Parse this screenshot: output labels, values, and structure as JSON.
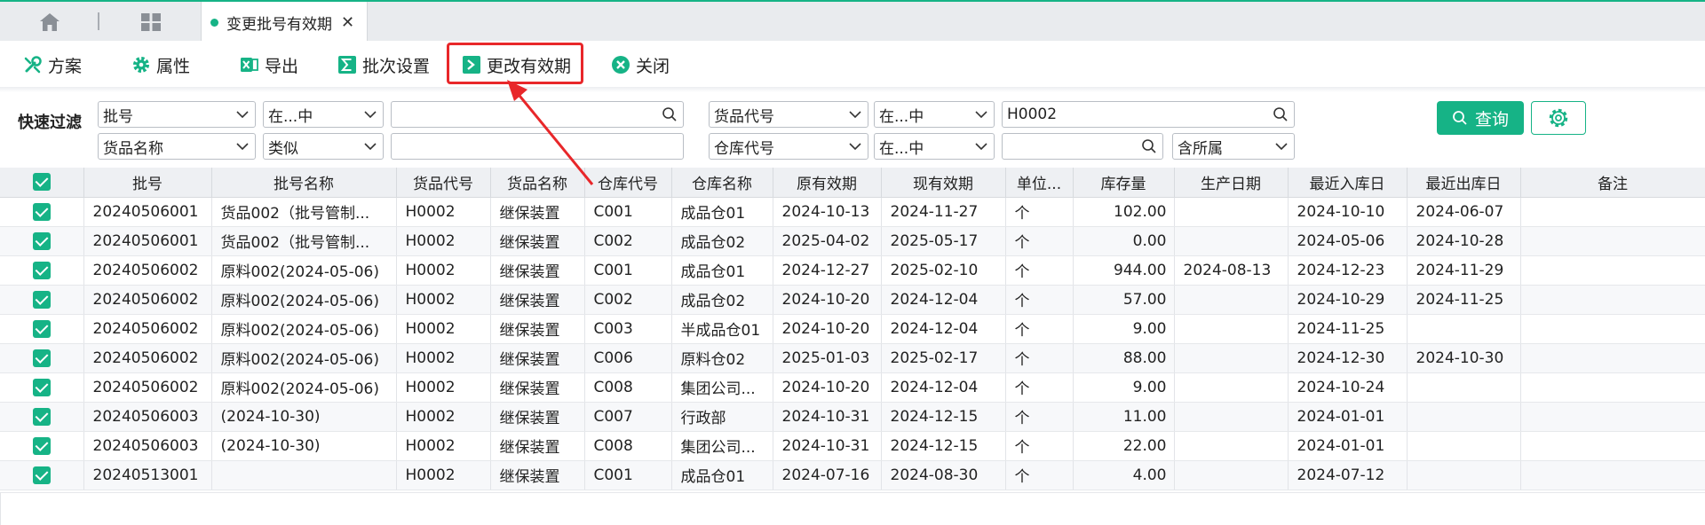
{
  "tabs": {
    "active_label": "变更批号有效期",
    "close_glyph": "✕"
  },
  "toolbar": {
    "items": [
      {
        "label": "方案",
        "icon": "wrench-scheme-icon"
      },
      {
        "label": "属性",
        "icon": "gear-icon"
      },
      {
        "label": "导出",
        "icon": "excel-export-icon"
      },
      {
        "label": "批次设置",
        "icon": "sigma-icon"
      },
      {
        "label": "更改有效期",
        "icon": "terminal-arrow-icon"
      },
      {
        "label": "关闭",
        "icon": "close-circle-icon"
      }
    ]
  },
  "filter": {
    "title": "快速过滤",
    "row1": {
      "field1": "批号",
      "op1": "在...中",
      "value1": "",
      "field2": "货品代号",
      "op2": "在...中",
      "value2": "H0002"
    },
    "row2": {
      "field1": "货品名称",
      "op1": "类似",
      "value1": "",
      "field2": "仓库代号",
      "op2": "在...中",
      "value2": "",
      "scope": "含所属"
    },
    "query_label": "查询"
  },
  "grid": {
    "columns": [
      "批号",
      "批号名称",
      "货品代号",
      "货品名称",
      "仓库代号",
      "仓库名称",
      "原有效期",
      "现有效期",
      "单位...",
      "库存量",
      "生产日期",
      "最近入库日",
      "最近出库日",
      "备注"
    ],
    "rows": [
      [
        "20240506001",
        "货品002（批号管制...",
        "H0002",
        "继保装置",
        "C001",
        "成品仓01",
        "2024-10-13",
        "2024-11-27",
        "个",
        "102.00",
        "",
        "2024-10-10",
        "2024-06-07",
        ""
      ],
      [
        "20240506001",
        "货品002（批号管制...",
        "H0002",
        "继保装置",
        "C002",
        "成品仓02",
        "2025-04-02",
        "2025-05-17",
        "个",
        "0.00",
        "",
        "2024-05-06",
        "2024-10-28",
        ""
      ],
      [
        "20240506002",
        "原料002(2024-05-06)",
        "H0002",
        "继保装置",
        "C001",
        "成品仓01",
        "2024-12-27",
        "2025-02-10",
        "个",
        "944.00",
        "2024-08-13",
        "2024-12-23",
        "2024-11-29",
        ""
      ],
      [
        "20240506002",
        "原料002(2024-05-06)",
        "H0002",
        "继保装置",
        "C002",
        "成品仓02",
        "2024-10-20",
        "2024-12-04",
        "个",
        "57.00",
        "",
        "2024-10-29",
        "2024-11-25",
        ""
      ],
      [
        "20240506002",
        "原料002(2024-05-06)",
        "H0002",
        "继保装置",
        "C003",
        "半成品仓01",
        "2024-10-20",
        "2024-12-04",
        "个",
        "9.00",
        "",
        "2024-11-25",
        "",
        ""
      ],
      [
        "20240506002",
        "原料002(2024-05-06)",
        "H0002",
        "继保装置",
        "C006",
        "原料仓02",
        "2025-01-03",
        "2025-02-17",
        "个",
        "88.00",
        "",
        "2024-12-30",
        "2024-10-30",
        ""
      ],
      [
        "20240506002",
        "原料002(2024-05-06)",
        "H0002",
        "继保装置",
        "C008",
        "集团公司...",
        "2024-10-20",
        "2024-12-04",
        "个",
        "9.00",
        "",
        "2024-10-24",
        "",
        ""
      ],
      [
        "20240506003",
        "(2024-10-30)",
        "H0002",
        "继保装置",
        "C007",
        "行政部",
        "2024-10-31",
        "2024-12-15",
        "个",
        "11.00",
        "",
        "2024-01-01",
        "",
        ""
      ],
      [
        "20240506003",
        "(2024-10-30)",
        "H0002",
        "继保装置",
        "C008",
        "集团公司...",
        "2024-10-31",
        "2024-12-15",
        "个",
        "22.00",
        "",
        "2024-01-01",
        "",
        ""
      ],
      [
        "20240513001",
        "",
        "H0002",
        "继保装置",
        "C001",
        "成品仓01",
        "2024-07-16",
        "2024-08-30",
        "个",
        "4.00",
        "",
        "2024-07-12",
        "",
        ""
      ]
    ]
  },
  "colors": {
    "accent": "#16b386",
    "highlight": "#e8272a"
  }
}
